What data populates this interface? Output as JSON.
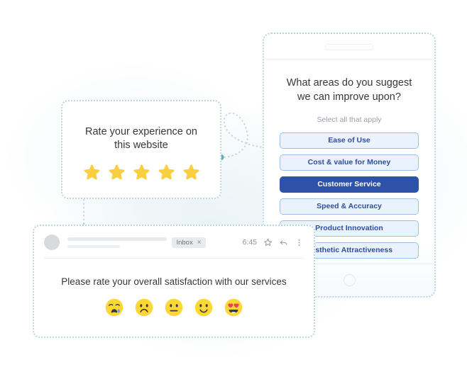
{
  "theme": {
    "accent_blue": "#2d52a8",
    "chip_blue_bg": "#eaf3fd",
    "chip_blue_border": "#9fc0e8",
    "chip_blue_text": "#2f4e9d",
    "star_yellow": "#f8cf3e",
    "emoji_yellow": "#fcd736",
    "dot_teal": "#6aa8b5",
    "card_border": "#bcd6de",
    "text_dark": "#35383d",
    "text_muted": "#9aa1a8"
  },
  "star_card": {
    "title": "Rate your experience on this website",
    "stars_total": 5,
    "stars_filled": 5,
    "star_icon": "star-icon"
  },
  "tablet": {
    "speaker_icon": "speaker-bar-icon",
    "home_button_icon": "home-button-icon",
    "question": "What areas do you suggest we can improve upon?",
    "subtitle": "Select all that apply",
    "choices": [
      {
        "label": "Ease of Use",
        "selected": false
      },
      {
        "label": "Cost & value for Money",
        "selected": false
      },
      {
        "label": "Customer Service",
        "selected": true
      },
      {
        "label": "Speed & Accuracy",
        "selected": false
      },
      {
        "label": "Product Innovation",
        "selected": false
      },
      {
        "label": "Aesthetic Attractiveness",
        "selected": false
      }
    ]
  },
  "email_card": {
    "avatar_icon": "avatar-icon",
    "label_chip": "Inbox",
    "label_chip_close_icon": "close-icon",
    "close_glyph": "×",
    "time": "6:45",
    "star_icon": "star-outline-icon",
    "reply_icon": "reply-icon",
    "more_icon": "more-vertical-icon",
    "prompt": "Please rate your overall satisfaction with our services",
    "emojis": [
      {
        "name": "crying-face-emoji",
        "value": 1
      },
      {
        "name": "frowning-face-emoji",
        "value": 2
      },
      {
        "name": "neutral-face-emoji",
        "value": 3
      },
      {
        "name": "slightly-smiling-face-emoji",
        "value": 4
      },
      {
        "name": "heart-eyes-face-emoji",
        "value": 5
      }
    ]
  },
  "connectors": {
    "dot_left_name": "connector-dot-email",
    "dot_right_name": "connector-dot-star"
  }
}
